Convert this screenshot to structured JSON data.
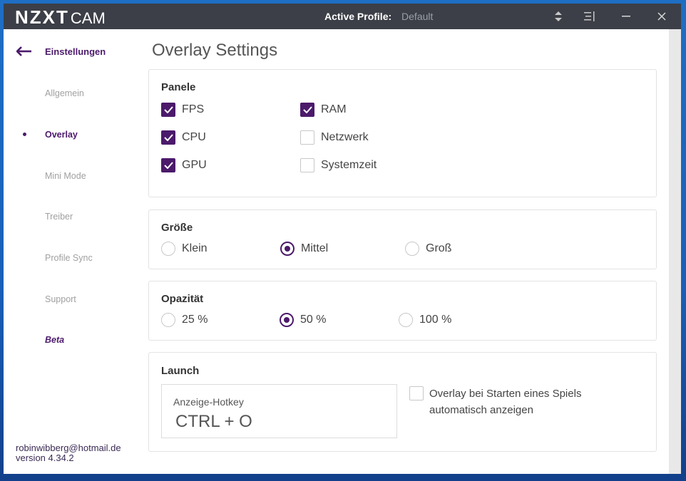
{
  "titlebar": {
    "logo_bold": "NZXT",
    "logo_thin": "CAM",
    "active_profile_label": "Active Profile:",
    "active_profile_value": "Default"
  },
  "sidebar": {
    "title": "Einstellungen",
    "items": [
      {
        "label": "Allgemein"
      },
      {
        "label": "Overlay"
      },
      {
        "label": "Mini Mode"
      },
      {
        "label": "Treiber"
      },
      {
        "label": "Profile Sync"
      },
      {
        "label": "Support"
      },
      {
        "label": "Beta"
      }
    ],
    "active_item": "Overlay",
    "email": "robinwibberg@hotmail.de",
    "version": "version 4.34.2"
  },
  "page": {
    "title": "Overlay Settings"
  },
  "panels": {
    "title": "Panele",
    "options": [
      {
        "label": "FPS",
        "checked": true
      },
      {
        "label": "CPU",
        "checked": true
      },
      {
        "label": "GPU",
        "checked": true
      },
      {
        "label": "RAM",
        "checked": true
      },
      {
        "label": "Netzwerk",
        "checked": false
      },
      {
        "label": "Systemzeit",
        "checked": false
      }
    ]
  },
  "size": {
    "title": "Größe",
    "options": [
      {
        "label": "Klein",
        "selected": false
      },
      {
        "label": "Mittel",
        "selected": true
      },
      {
        "label": "Groß",
        "selected": false
      }
    ]
  },
  "opacity": {
    "title": "Opazität",
    "options": [
      {
        "label": "25 %",
        "selected": false
      },
      {
        "label": "50 %",
        "selected": true
      },
      {
        "label": "100 %",
        "selected": false
      }
    ]
  },
  "launch": {
    "title": "Launch",
    "hotkey_label": "Anzeige-Hotkey",
    "hotkey_value": "CTRL + O",
    "auto_show_line1": "Overlay bei Starten eines Spiels",
    "auto_show_line2": "automatisch anzeigen",
    "auto_show_checked": false
  },
  "colors": {
    "accent": "#4b1a6b",
    "titlebar": "#3c3f47"
  }
}
